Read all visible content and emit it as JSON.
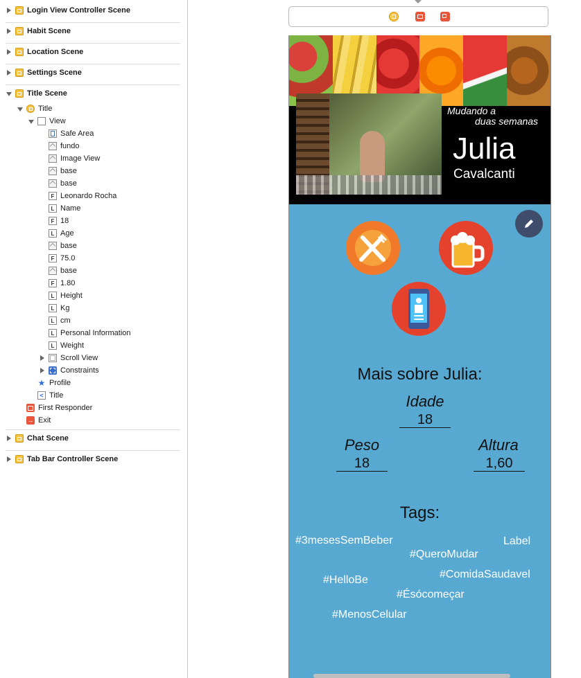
{
  "outline": {
    "scenes_top": [
      "Login View Controller Scene",
      "Habit Scene",
      "Location Scene",
      "Settings Scene"
    ],
    "title_scene": "Title Scene",
    "title_vc": "Title",
    "view": "View",
    "view_children": [
      "Safe Area",
      "fundo",
      "Image View",
      "base",
      "base",
      "Leonardo Rocha",
      "Name",
      "18",
      "Age",
      "base",
      "75.0",
      "base",
      "1.80",
      "Height",
      "Kg",
      "cm",
      "Personal Information",
      "Weight"
    ],
    "scroll_view": "Scroll View",
    "constraints": "Constraints",
    "profile": "Profile",
    "title_segue": "Title",
    "first_responder": "First Responder",
    "exit": "Exit",
    "scenes_bottom": [
      "Chat Scene",
      "Tab Bar Controller Scene"
    ]
  },
  "header": {
    "subtitle_line1": "Mudando a",
    "subtitle_line2": "duas semanas",
    "first_name": "Julia",
    "last_name": "Cavalcanti"
  },
  "info": {
    "title": "Mais sobre Julia:",
    "age_label": "Idade",
    "age_value": "18",
    "weight_label": "Peso",
    "weight_value": "18",
    "height_label": "Altura",
    "height_value": "1,60"
  },
  "tags": {
    "title": "Tags:",
    "items": [
      "#3mesesSemBeber",
      "Label",
      "#QueroMudar",
      "#ComidaSaudavel",
      "#HelloBe",
      "#Ésócomeçar",
      "#MenosCelular"
    ]
  },
  "colors": {
    "background": "#58a9d2",
    "header": "#000000",
    "edit_button": "#3f4d6b",
    "icon_orange": "#f07a2a",
    "icon_red": "#e5422e"
  }
}
